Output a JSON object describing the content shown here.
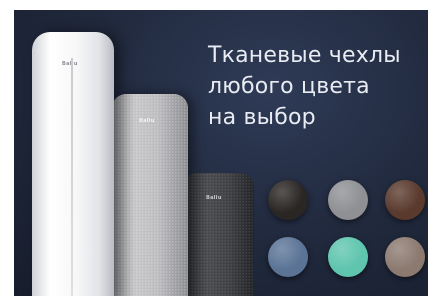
{
  "headline": {
    "line1": "Тканевые чехлы",
    "line2": "любого цвета",
    "line3": "на выбор"
  },
  "products": [
    {
      "logo": "Ballu",
      "finish": "white"
    },
    {
      "logo": "Ballu",
      "finish": "light-gray-fabric"
    },
    {
      "logo": "Ballu",
      "finish": "dark-gray-fabric"
    }
  ],
  "swatches": [
    {
      "color": "#2a2624"
    },
    {
      "color": "#8e9093"
    },
    {
      "color": "#5a3a2d"
    },
    {
      "color": "#5b7496"
    },
    {
      "color": "#5fc5ae"
    },
    {
      "color": "#8c7a70"
    }
  ]
}
